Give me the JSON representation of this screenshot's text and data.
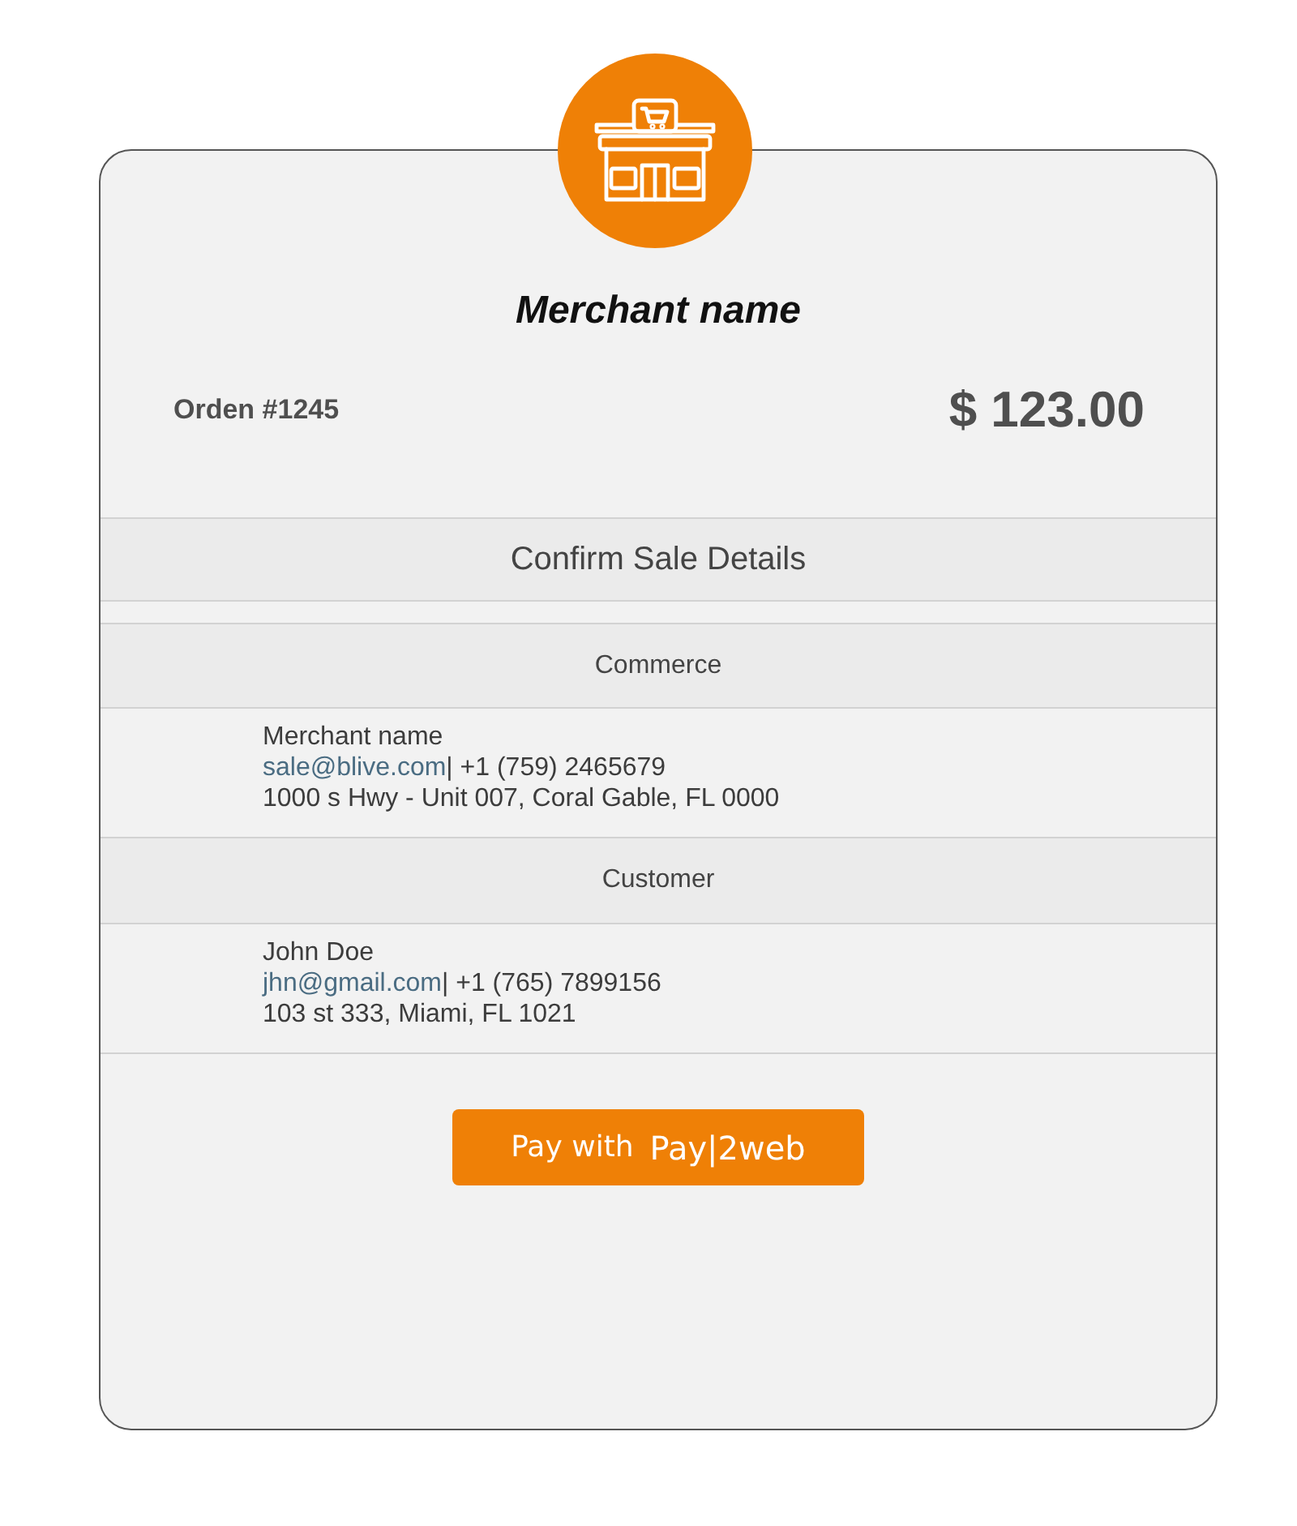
{
  "merchant": {
    "name": "Merchant name"
  },
  "order": {
    "number": "Orden #1245",
    "amount": "$ 123.00"
  },
  "title": "Confirm Sale Details",
  "sections": [
    {
      "heading": "Commerce",
      "name": "Merchant name",
      "email": "sale@blive.com",
      "phone": "| +1 (759) 2465679",
      "address": "1000 s Hwy - Unit 007, Coral Gable, FL 0000"
    },
    {
      "heading": "Customer",
      "name": "John Doe",
      "email": "jhn@gmail.com",
      "phone": "| +1 (765) 7899156",
      "address": "103 st 333, Miami, FL 1021"
    }
  ],
  "pay_button": {
    "label": "Pay with",
    "brand": "Pay|2web"
  }
}
